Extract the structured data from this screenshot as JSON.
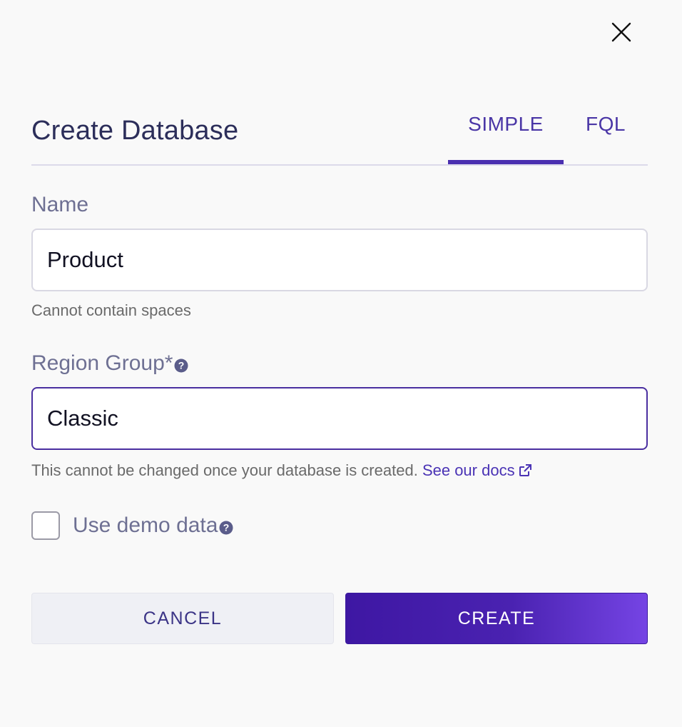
{
  "dialog": {
    "title": "Create Database",
    "tabs": [
      {
        "label": "SIMPLE",
        "active": true
      },
      {
        "label": "FQL",
        "active": false
      }
    ]
  },
  "name_field": {
    "label": "Name",
    "value": "Product",
    "hint": "Cannot contain spaces"
  },
  "region_field": {
    "label": "Region Group*",
    "value": "Classic",
    "hint": "This cannot be changed once your database is created.",
    "docs_link": "See our docs"
  },
  "demo_data": {
    "label": "Use demo data",
    "checked": false
  },
  "actions": {
    "cancel_label": "CANCEL",
    "create_label": "CREATE"
  },
  "icons": {
    "close": "close-icon",
    "help": "help-circle-icon",
    "external": "external-link-icon"
  },
  "colors": {
    "accent": "#4a2fb0",
    "create_gradient_start": "#3e17a3",
    "create_gradient_end": "#7544e4",
    "link": "#4a33b5"
  }
}
